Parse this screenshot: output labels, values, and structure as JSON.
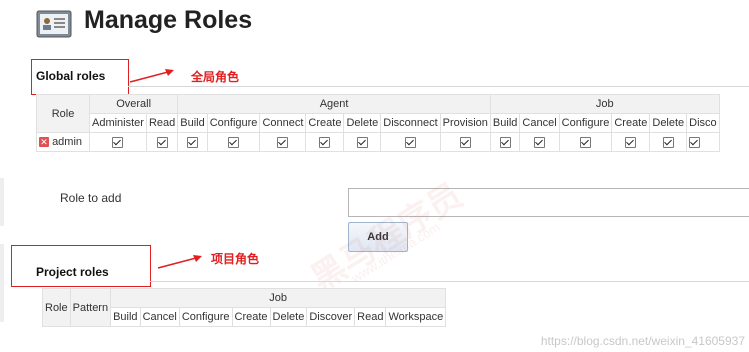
{
  "page": {
    "title": "Manage Roles"
  },
  "global": {
    "section_title": "Global roles",
    "callout": "全局角色",
    "groups": [
      {
        "label": "Overall"
      },
      {
        "label": "Agent"
      },
      {
        "label": "Job"
      }
    ],
    "role_header": "Role",
    "permissions": {
      "overall": [
        "Administer",
        "Read"
      ],
      "agent": [
        "Build",
        "Configure",
        "Connect",
        "Create",
        "Delete",
        "Disconnect",
        "Provision"
      ],
      "job": [
        "Build",
        "Cancel",
        "Configure",
        "Create",
        "Delete",
        "Disco"
      ]
    },
    "rows": [
      {
        "role": "admin"
      }
    ]
  },
  "role_to_add": {
    "label": "Role to add",
    "value": "",
    "button": "Add"
  },
  "project": {
    "section_title": "Project roles",
    "callout": "项目角色",
    "role_header": "Role",
    "pattern_header": "Pattern",
    "group": "Job",
    "permissions": [
      "Build",
      "Cancel",
      "Configure",
      "Create",
      "Delete",
      "Discover",
      "Read",
      "Workspace"
    ]
  },
  "watermark": {
    "brand": "黑马程序员",
    "url": "www.itheima.com"
  },
  "footer": {
    "url": "https://blog.csdn.net/weixin_41605937"
  },
  "colors": {
    "callout": "#e02020",
    "header_bg": "#f2f2f2",
    "button_border": "#9fb4cf"
  }
}
